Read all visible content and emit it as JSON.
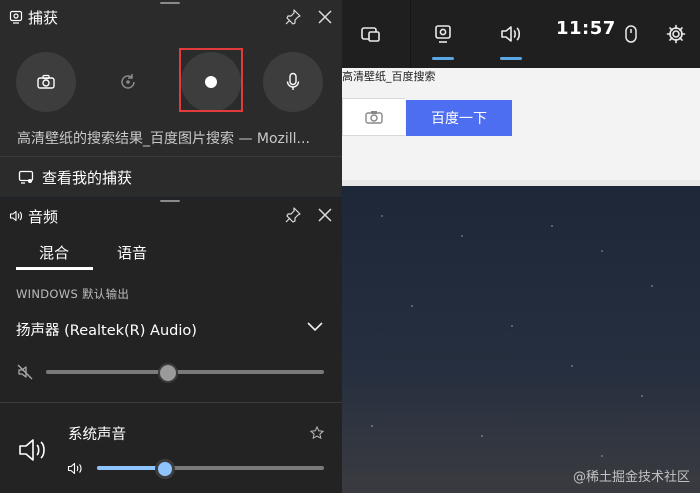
{
  "gamebar": {
    "time": "11:57"
  },
  "browser": {
    "tab_text": "高清壁纸_百度搜索",
    "search_button": "百度一下"
  },
  "watermark": "@稀土掘金技术社区",
  "capture": {
    "title": "捕获",
    "window_title": "高清壁纸的搜索结果_百度图片搜索 — Mozill...",
    "view_captures": "查看我的捕获"
  },
  "audio": {
    "title": "音频",
    "tabs": [
      "混合",
      "语音"
    ],
    "output_label": "WINDOWS 默认输出",
    "device": "扬声器 (Realtek(R) Audio)",
    "device_volume_pct": 44,
    "system_sound_label": "系统声音",
    "system_volume_pct": 30
  },
  "colors": {
    "accent": "#5aa7e6",
    "record_highlight": "#e23b3b",
    "baidu_blue": "#4e6ef2"
  }
}
